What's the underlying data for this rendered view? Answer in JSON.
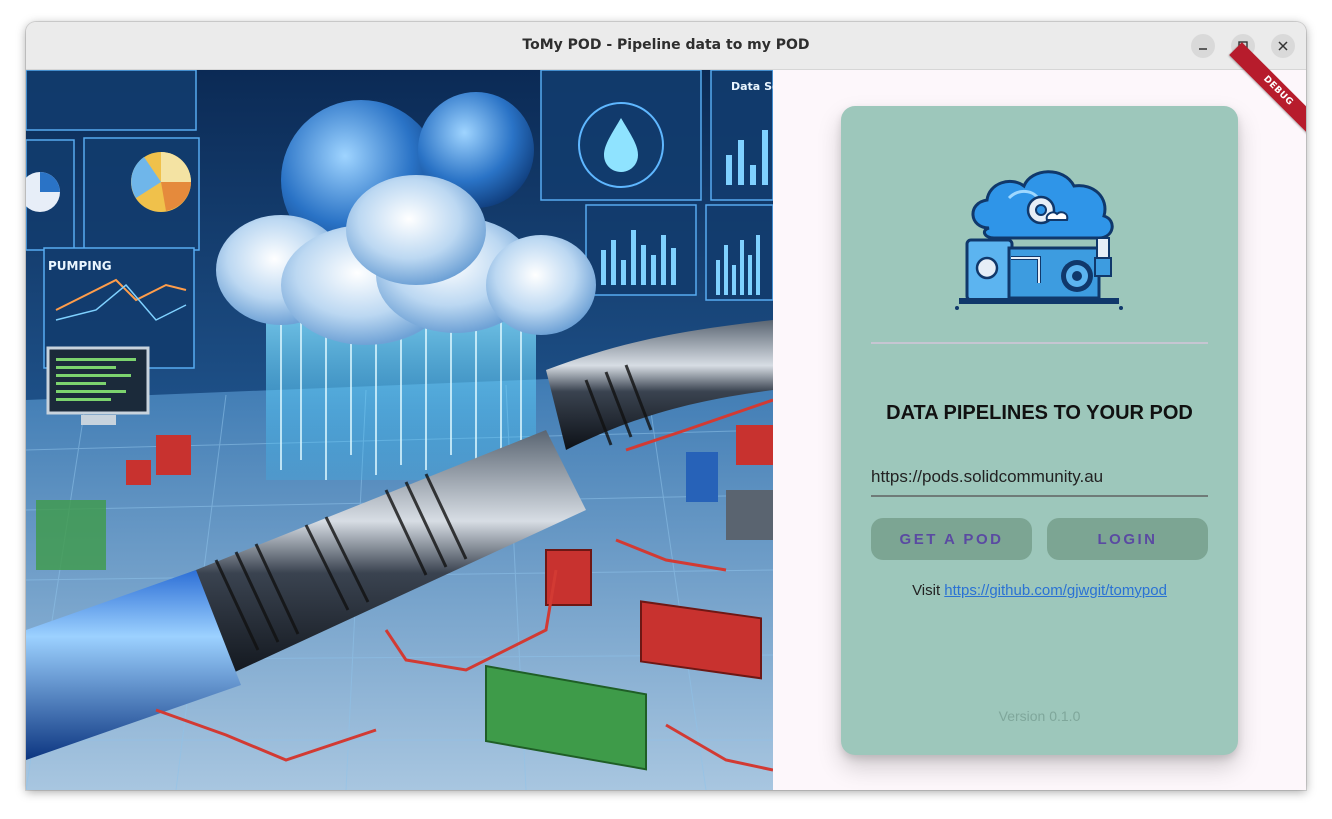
{
  "window": {
    "title": "ToMy POD - Pipeline data to my POD"
  },
  "titlebar_buttons": [
    "minimize-icon",
    "maximize-icon",
    "close-icon"
  ],
  "hero": {
    "labels": {
      "pumping": "PUMPING",
      "data": "Data Se"
    }
  },
  "debug_banner": "DEBUG",
  "card": {
    "heading": "DATA PIPELINES TO YOUR POD",
    "url_value": "https://pods.solidcommunity.au",
    "get_pod_label": "GET A POD",
    "login_label": "LOGIN",
    "visit_prefix": "Visit ",
    "visit_link": "https://github.com/gjwgit/tomypod",
    "version": "Version 0.1.0"
  },
  "colors": {
    "card_bg": "#9dc7bb",
    "button_bg": "#7ca593",
    "button_text": "#5a4aa2",
    "link": "#2a72d4",
    "debug": "#b71c2c"
  }
}
